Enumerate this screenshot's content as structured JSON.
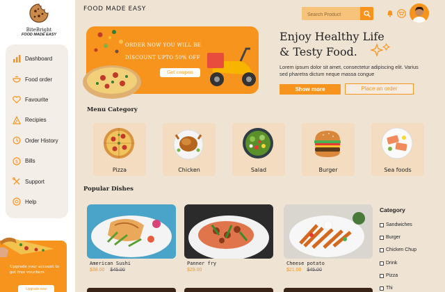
{
  "logo": {
    "name": "BiteBright",
    "tagline": "FOOD MADE EASY"
  },
  "sidebar": {
    "items": [
      {
        "label": "Dashboard",
        "icon": "bar-chart-icon"
      },
      {
        "label": "Food order",
        "icon": "food-bowl-icon"
      },
      {
        "label": "Favourite",
        "icon": "heart-icon"
      },
      {
        "label": "Recipies",
        "icon": "pizza-slice-icon"
      },
      {
        "label": "Order History",
        "icon": "history-icon"
      },
      {
        "label": "Bills",
        "icon": "dollar-icon"
      },
      {
        "label": "Support",
        "icon": "tools-icon"
      },
      {
        "label": "Help",
        "icon": "help-icon"
      }
    ],
    "promo": {
      "text": "Upgrade your account to get free vouchers",
      "button": "Upgrade now"
    }
  },
  "header": {
    "title": "FOOD MADE EASY",
    "search_placeholder": "Search Product"
  },
  "banner": {
    "text": "ORDER NOW YOU WILL BE DISCOUNT UPTO 50% OFF",
    "button": "Get coupon"
  },
  "hero": {
    "heading_line1": "Enjoy Healthy Life",
    "heading_line2": "& Testy Food.",
    "paragraph": "Lorem ipsum dolor sit amet, consectetur adipiscing elit. Varius sed pharetra dictum neque massa congue",
    "primary_button": "Show more",
    "secondary_button": "Place an order"
  },
  "menu_category": {
    "title": "Menu Category",
    "items": [
      "Pizza",
      "Chicken",
      "Salad",
      "Burger",
      "Sea foods"
    ]
  },
  "popular": {
    "title": "Popular Dishes",
    "dishes": [
      {
        "name": "American Sushi",
        "price": "$38.00",
        "old_price": "$45.00"
      },
      {
        "name": "Panner fry",
        "price": "$29.00",
        "old_price": ""
      },
      {
        "name": "Cheese potato",
        "price": "$21.00",
        "old_price": "$45.00"
      }
    ]
  },
  "filter": {
    "title": "Category",
    "items": [
      "Sandwiches",
      "Burger",
      "Chicken Chup",
      "Drink",
      "Pizza",
      "Thi"
    ]
  },
  "colors": {
    "accent": "#f7941d",
    "background": "#efe3d4",
    "card": "#f3dcbf"
  }
}
